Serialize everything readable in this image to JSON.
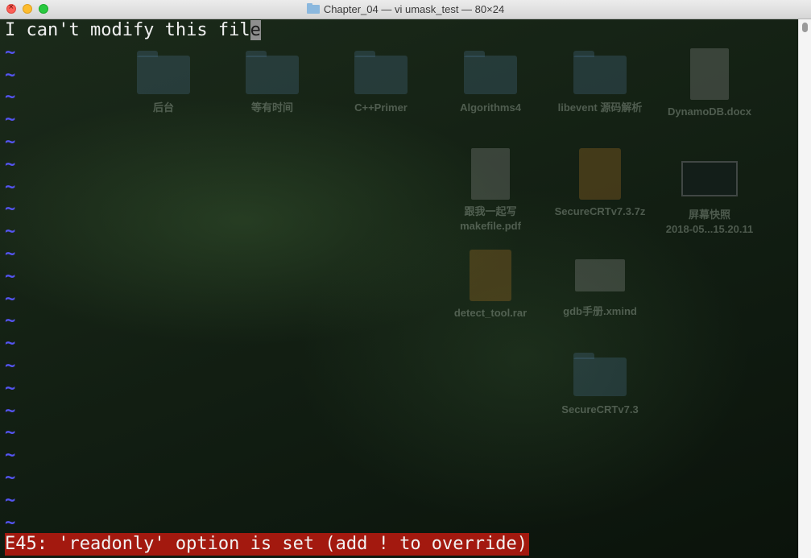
{
  "window": {
    "title": "Chapter_04 — vi umask_test — 80×24",
    "title_icon": "folder-icon"
  },
  "editor": {
    "first_line": "I can't modify this fil",
    "cursor_char": "e",
    "tilde_char": "~",
    "tilde_count": 22,
    "error_message": "E45: 'readonly' option is set (add ! to override)"
  },
  "colors": {
    "tilde": "#5454f0",
    "error_bg": "#a3190f",
    "text": "#f0f0f0"
  },
  "desktop": {
    "items": [
      {
        "label": "后台",
        "icon": "folder-icon"
      },
      {
        "label": "等有时间",
        "icon": "folder-icon"
      },
      {
        "label": "C++Primer",
        "icon": "folder-icon"
      },
      {
        "label": "Algorithms4",
        "icon": "folder-icon"
      },
      {
        "label": "libevent 源码解析",
        "icon": "folder-icon"
      },
      {
        "label": "DynamoDB.docx",
        "icon": "document-icon"
      },
      {
        "label": "跟我一起写\nmakefile.pdf",
        "icon": "pdf-icon"
      },
      {
        "label": "SecureCRTv7.3.7z",
        "icon": "archive-icon"
      },
      {
        "label": "屏幕快照\n2018-05...15.20.11",
        "icon": "screenshot-icon"
      },
      {
        "label": "detect_tool.rar",
        "icon": "archive-icon"
      },
      {
        "label": "gdb手册.xmind",
        "icon": "document-icon"
      },
      {
        "label": "SecureCRTv7.3",
        "icon": "folder-icon"
      }
    ]
  }
}
